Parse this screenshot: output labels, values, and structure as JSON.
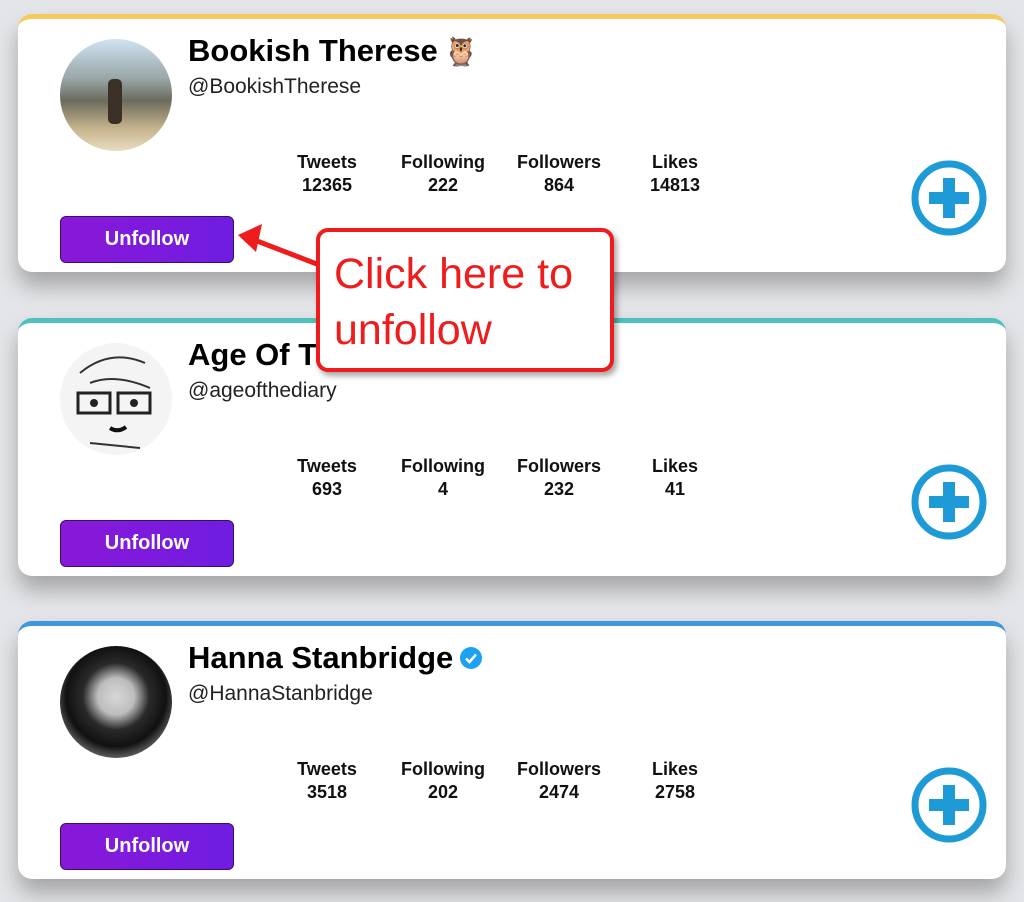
{
  "stat_labels": {
    "tweets": "Tweets",
    "following": "Following",
    "followers": "Followers",
    "likes": "Likes"
  },
  "button_label": "Unfollow",
  "accent_colors": {
    "card1": "#f5c95a",
    "card2": "#4fc1bc",
    "card3": "#3f97dd",
    "button": "#7a1be0",
    "plus": "#1e9bd7",
    "callout": "#ee1c1c"
  },
  "cards": [
    {
      "name": "Bookish Therese",
      "name_emoji": "🦉",
      "handle": "@BookishTherese",
      "tweets": "12365",
      "following": "222",
      "followers": "864",
      "likes": "14813"
    },
    {
      "name": "Age Of T",
      "handle": "@ageofthediary",
      "tweets": "693",
      "following": "4",
      "followers": "232",
      "likes": "41"
    },
    {
      "name": "Hanna Stanbridge",
      "verified": true,
      "handle": "@HannaStanbridge",
      "tweets": "3518",
      "following": "202",
      "followers": "2474",
      "likes": "2758"
    }
  ],
  "callout": {
    "line1": "Click here to",
    "line2": "unfollow"
  }
}
